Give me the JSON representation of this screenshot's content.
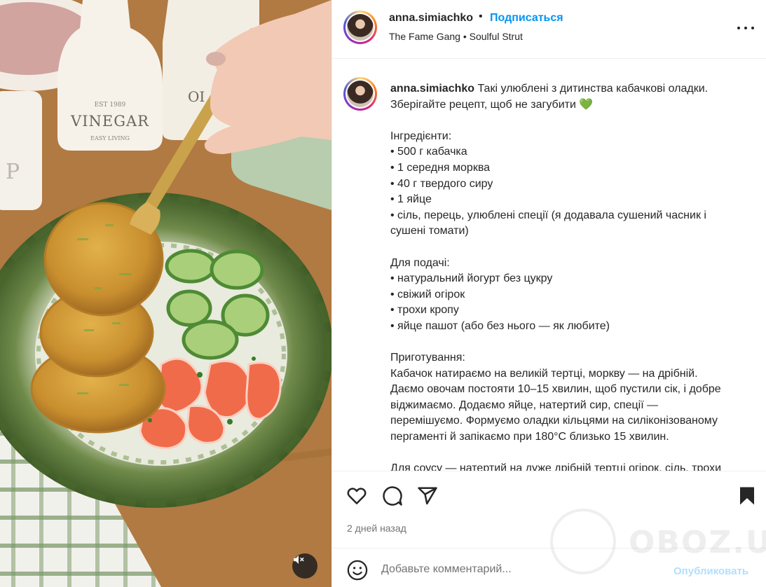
{
  "post": {
    "username": "anna.simiachko",
    "separator": "•",
    "follow_label": "Подписаться",
    "music": "The Fame Gang • Soulful Strut"
  },
  "caption": {
    "author": "anna.simiachko",
    "first_line_text": " Такі улюблені з дитинства кабачкові оладки.",
    "lines": [
      "Зберігайте рецепт, щоб не загубити 💚",
      "",
      "Інгредієнти:",
      "• 500 г кабачка",
      "• 1 середня морква",
      "• 40 г твердого сиру",
      "• 1 яйце",
      "• сіль, перець, улюблені спеції (я додавала сушений часник і",
      "сушені томати)",
      "",
      "Для подачі:",
      "• натуральний йогурт без цукру",
      "• свіжий огірок",
      "• трохи кропу",
      "• яйце пашот (або без нього — як любите)",
      "",
      "Приготування:",
      "Кабачок натираємо на великій тертці, моркву — на дрібній.",
      "Даємо овочам постояти 10–15 хвилин, щоб пустили сік, і добре",
      "віджимаємо. Додаємо яйце, натертий сир, спеції —",
      "перемішуємо. Формуємо оладки кільцями на силіконізованому",
      "пергаменті й запікаємо при 180°C близько 15 хвилин.",
      "",
      "Для соусу — натертий на дуже дрібній тертці огірок, сіль, трохи"
    ]
  },
  "media": {
    "bottle_labels": [
      "VINEGAR",
      "EST 1989",
      "EASY LIVING",
      "OI"
    ]
  },
  "actions": {
    "like_icon": "heart-icon",
    "comment_icon": "comment-icon",
    "share_icon": "share-icon",
    "save_icon": "bookmark-icon"
  },
  "timestamp": "2 дней назад",
  "comment": {
    "placeholder": "Добавьте комментарий...",
    "publish_label": "Опубликовать"
  },
  "watermark": "OBOZ.UA",
  "colors": {
    "accent": "#0095f6",
    "publish_disabled": "#b2dffc",
    "text": "#262626",
    "muted": "#737373"
  }
}
